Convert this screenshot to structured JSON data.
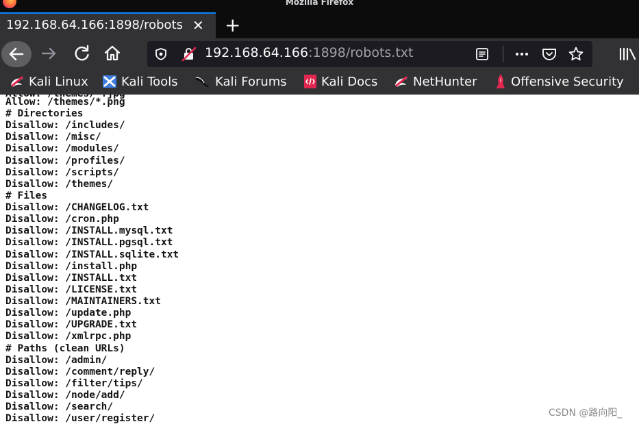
{
  "window": {
    "title": "Mozilla Firefox"
  },
  "tab": {
    "title": "192.168.64.166:1898/robots",
    "close": "✕",
    "new_tab": "+"
  },
  "urlbar": {
    "host": "192.168.64.166",
    "rest": ":1898/robots.txt"
  },
  "bookmarks": [
    {
      "label": "Kali Linux",
      "icon": "kali-dragon-icon"
    },
    {
      "label": "Kali Tools",
      "icon": "kali-tools-icon"
    },
    {
      "label": "Kali Forums",
      "icon": "kali-forums-icon"
    },
    {
      "label": "Kali Docs",
      "icon": "kali-docs-icon"
    },
    {
      "label": "NetHunter",
      "icon": "nethunter-icon"
    },
    {
      "label": "Offensive Security",
      "icon": "offensive-security-icon"
    }
  ],
  "content": {
    "partial_top": "Allow: /themes/*.jpg",
    "lines": [
      "Allow: /themes/*.png",
      "# Directories",
      "Disallow: /includes/",
      "Disallow: /misc/",
      "Disallow: /modules/",
      "Disallow: /profiles/",
      "Disallow: /scripts/",
      "Disallow: /themes/",
      "# Files",
      "Disallow: /CHANGELOG.txt",
      "Disallow: /cron.php",
      "Disallow: /INSTALL.mysql.txt",
      "Disallow: /INSTALL.pgsql.txt",
      "Disallow: /INSTALL.sqlite.txt",
      "Disallow: /install.php",
      "Disallow: /INSTALL.txt",
      "Disallow: /LICENSE.txt",
      "Disallow: /MAINTAINERS.txt",
      "Disallow: /update.php",
      "Disallow: /UPGRADE.txt",
      "Disallow: /xmlrpc.php",
      "# Paths (clean URLs)",
      "Disallow: /admin/",
      "Disallow: /comment/reply/",
      "Disallow: /filter/tips/",
      "Disallow: /node/add/",
      "Disallow: /search/",
      "Disallow: /user/register/"
    ]
  },
  "watermark": "CSDN @路向阳_"
}
